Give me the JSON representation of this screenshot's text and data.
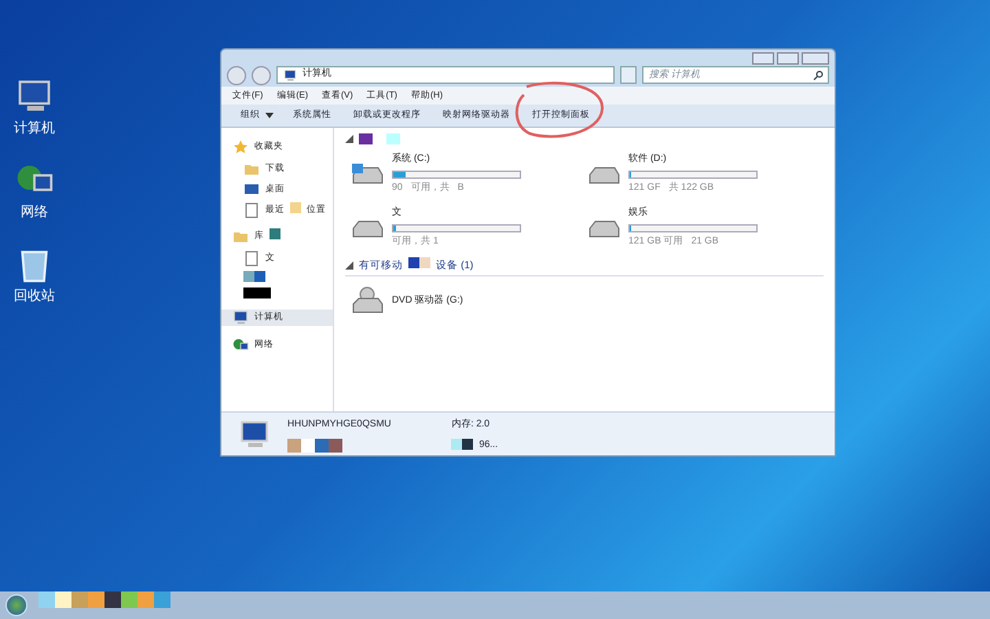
{
  "desktop_icons": [
    {
      "label": "计算机",
      "kind": "computer"
    },
    {
      "label": "网络",
      "kind": "network"
    },
    {
      "label": "回收站",
      "kind": "recycle"
    }
  ],
  "window": {
    "address": "计算机",
    "search": {
      "placeholder": "搜索 计算机"
    }
  },
  "menu": [
    "文件(F)",
    "编辑(E)",
    "查看(V)",
    "工具(T)",
    "帮助(H)"
  ],
  "toolbar": [
    {
      "label": "组织",
      "dropdown": true
    },
    {
      "label": "系统属性",
      "dropdown": false
    },
    {
      "label": "卸载或更改程序",
      "dropdown": false
    },
    {
      "label": "映射网络驱动器",
      "dropdown": false
    },
    {
      "label": "打开控制面板",
      "dropdown": false
    }
  ],
  "sidebar": [
    {
      "label": "收藏夹",
      "kind": "star",
      "selected": false,
      "children": [
        {
          "label": "下载",
          "kind": "folder",
          "selected": false
        },
        {
          "label": "桌面",
          "kind": "desktop",
          "selected": false
        },
        {
          "label": "最近",
          "suffix": "位置",
          "kind": "recent",
          "selected": false
        }
      ]
    },
    {
      "label": "库",
      "kind": "folder",
      "selected": false,
      "children": [
        {
          "label": "文",
          "kind": "doc",
          "selected": false
        }
      ]
    },
    {
      "label": "计算机",
      "kind": "computer",
      "selected": true
    },
    {
      "label": "网络",
      "kind": "network",
      "selected": false
    }
  ],
  "drives": [
    {
      "name": "系统 (C:)",
      "level": 0.1,
      "caption": [
        "90",
        "可用，共",
        "B"
      ],
      "system": true
    },
    {
      "name": "软件 (D:)",
      "level": 0.01,
      "caption": [
        "121 GF",
        "共 122 GB"
      ],
      "system": false
    },
    {
      "name": "文",
      "level": 0.02,
      "caption": [
        "可用，共 1"
      ],
      "system": false
    },
    {
      "name": "娱乐",
      "level": 0.01,
      "caption": [
        "121 GB 可用",
        "21 GB"
      ],
      "system": false
    }
  ],
  "removable": {
    "title": [
      "有可移动",
      "设备 (1)"
    ],
    "items": [
      {
        "name": "DVD 驱动器 (G:)"
      }
    ]
  },
  "details": {
    "name": "HHUNPMYHGE0QSMU",
    "memory": "内存: 2.0",
    "processor": "96..."
  }
}
